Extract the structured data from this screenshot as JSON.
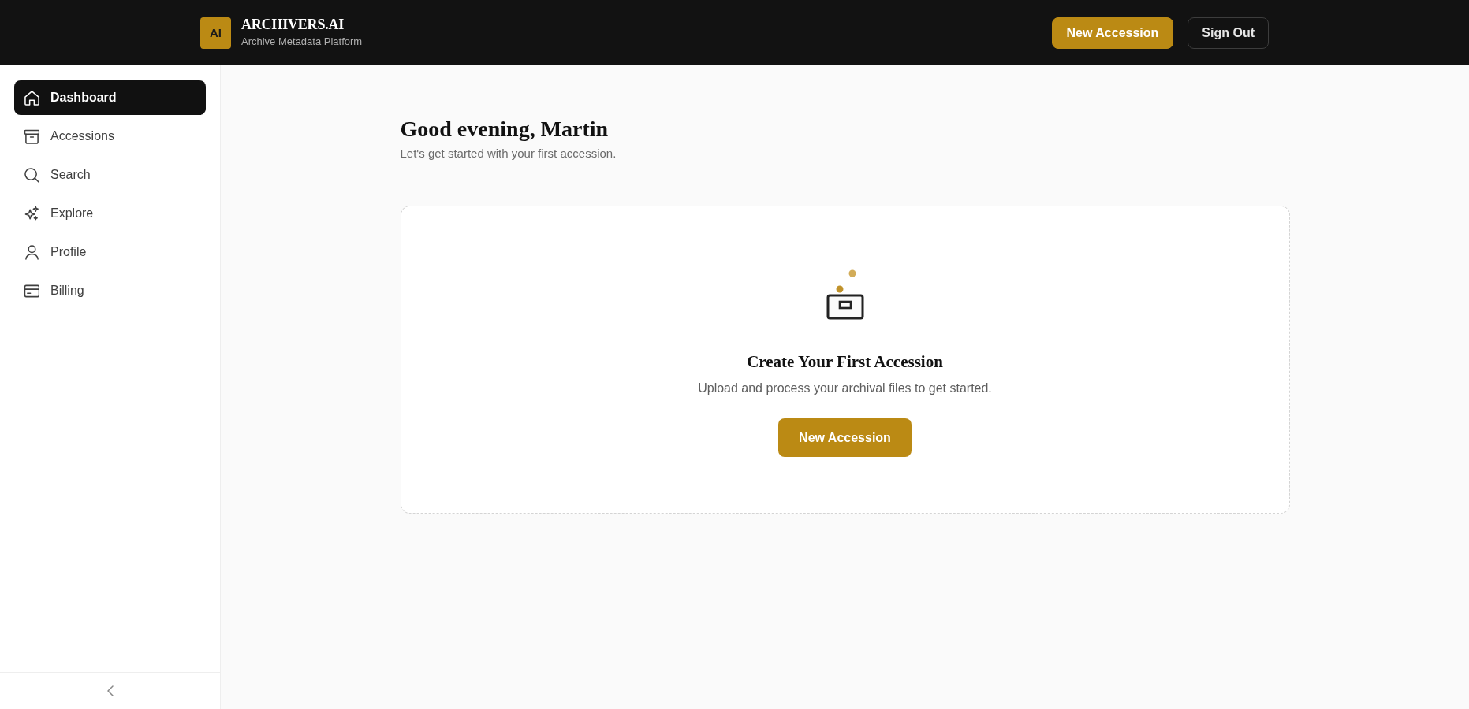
{
  "header": {
    "logo_badge": "AI",
    "title": "ARCHIVERS.AI",
    "subtitle": "Archive Metadata Platform",
    "actions": [
      {
        "label": "New Accession",
        "kind": "primary"
      },
      {
        "label": "Sign Out",
        "kind": "outline"
      }
    ]
  },
  "sidebar": {
    "items": [
      {
        "label": "Dashboard",
        "selected": true
      },
      {
        "label": "Accessions",
        "selected": false
      },
      {
        "label": "Search",
        "selected": false
      },
      {
        "label": "Explore",
        "selected": false
      },
      {
        "label": "Profile",
        "selected": false
      },
      {
        "label": "Billing",
        "selected": false
      }
    ]
  },
  "main": {
    "greeting": "Good evening, Martin",
    "subtitle": "Let's get started with your first accession.",
    "empty_state": {
      "title": "Create Your First Accession",
      "description": "Upload and process your archival files to get started.",
      "button": "New Accession"
    }
  }
}
